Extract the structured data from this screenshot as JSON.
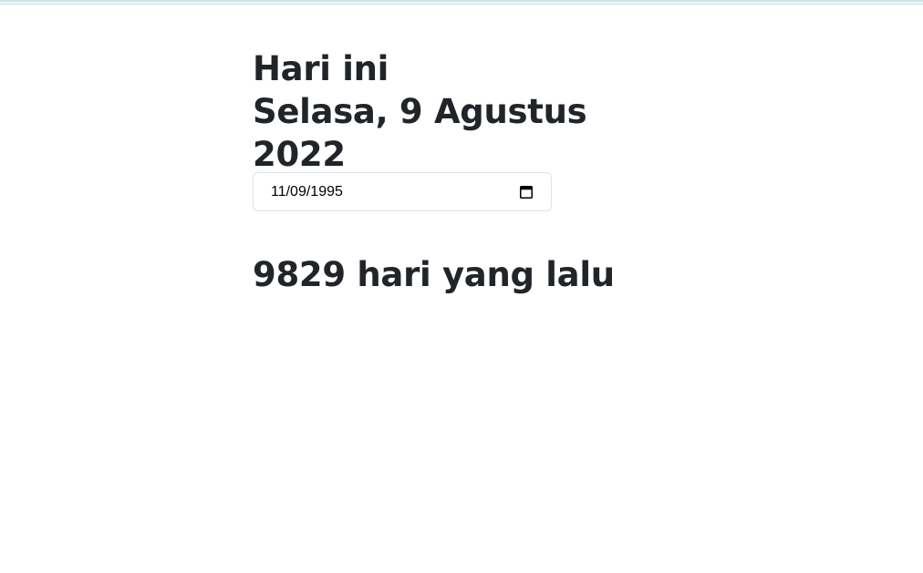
{
  "header": {
    "today_label": "Hari ini",
    "today_date": "Selasa, 9 Agustus 2022"
  },
  "date_input": {
    "value": "11/09/1995",
    "icon": "calendar-icon"
  },
  "result": {
    "text": "9829 hari yang lalu"
  },
  "colors": {
    "text": "#212529",
    "border": "#dee2e6",
    "top_bar": "#c8e4ea"
  }
}
